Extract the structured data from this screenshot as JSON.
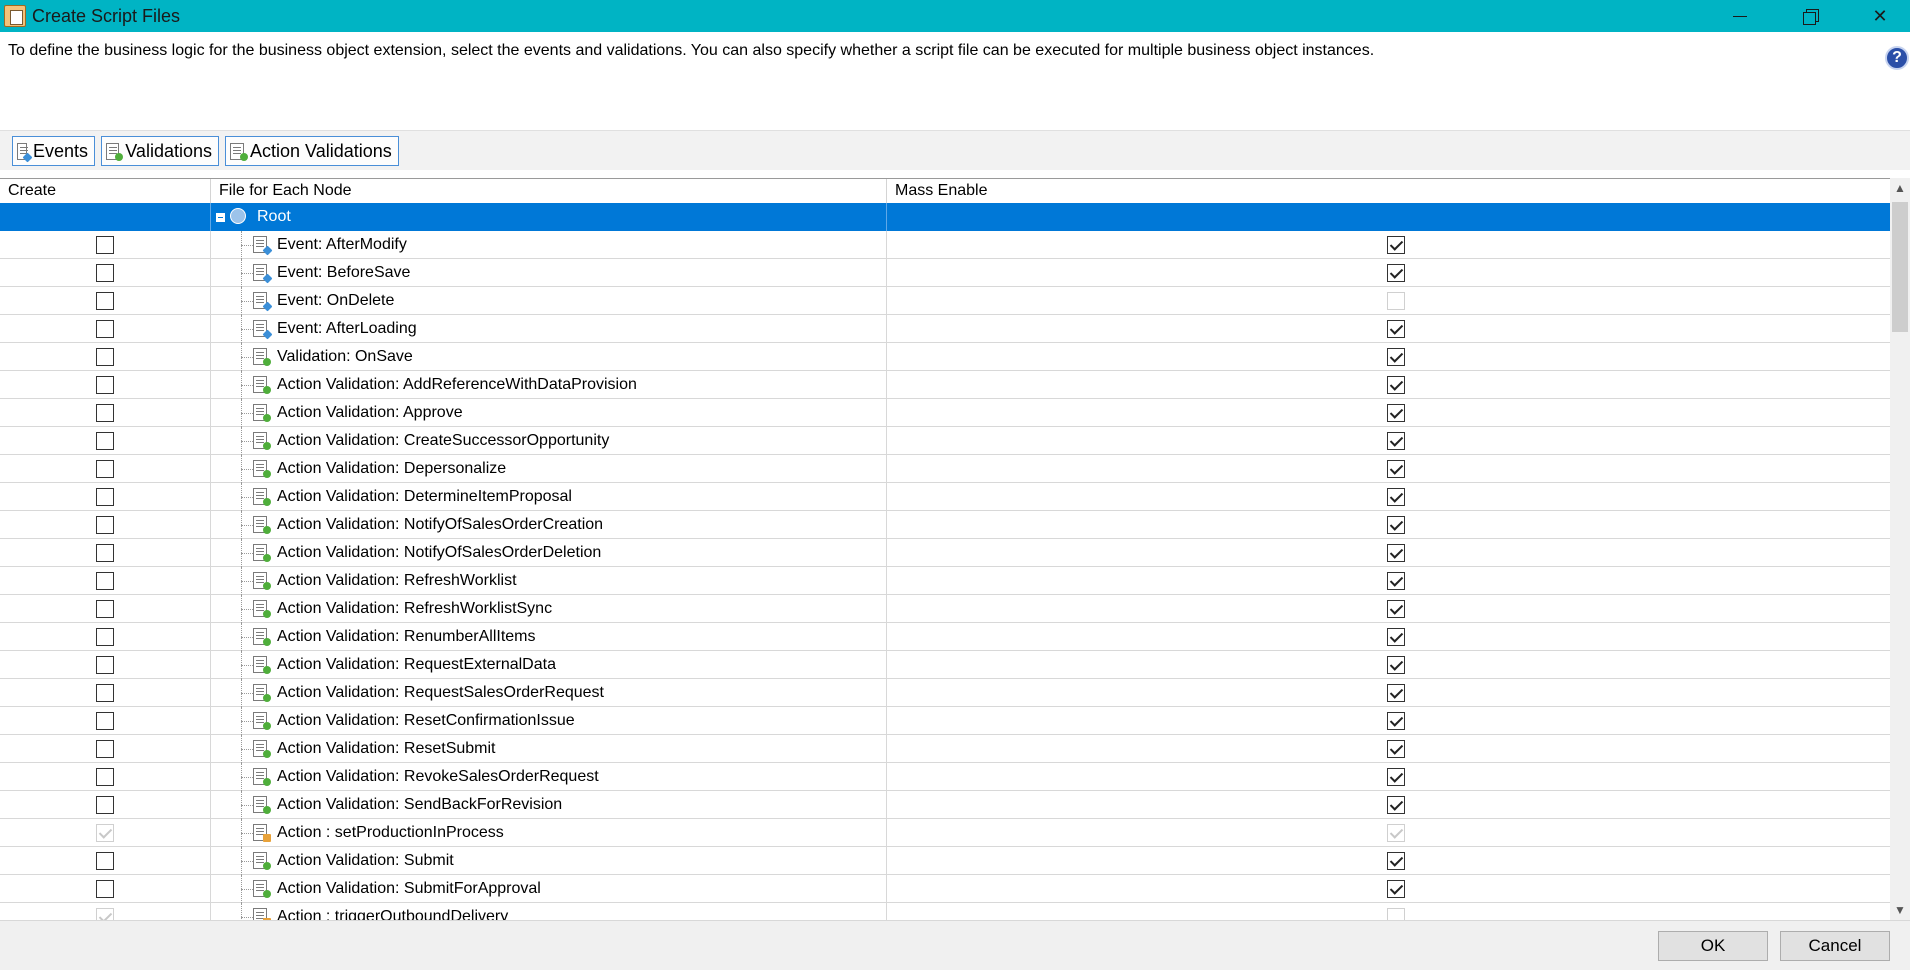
{
  "window": {
    "title": "Create Script Files",
    "title_bar_color": "#00b4c4"
  },
  "description": "To define the business logic for the business object extension, select the events and validations. You can also specify whether a script file can be executed for multiple business object instances.",
  "help": {
    "label": "?"
  },
  "toolbar": {
    "events_label": "Events",
    "validations_label": "Validations",
    "action_validations_label": "Action Validations"
  },
  "grid": {
    "columns": [
      "Create",
      "File for Each Node",
      "Mass Enable"
    ],
    "root": {
      "label": "Root",
      "selected_color": "#0078d7"
    },
    "rows": [
      {
        "label": "Event: AfterModify",
        "kind": "event",
        "create": false,
        "create_disabled": false,
        "mass": true,
        "mass_disabled": false
      },
      {
        "label": "Event: BeforeSave",
        "kind": "event",
        "create": false,
        "create_disabled": false,
        "mass": true,
        "mass_disabled": false
      },
      {
        "label": "Event: OnDelete",
        "kind": "event",
        "create": false,
        "create_disabled": false,
        "mass": false,
        "mass_disabled": true
      },
      {
        "label": "Event: AfterLoading",
        "kind": "event",
        "create": false,
        "create_disabled": false,
        "mass": true,
        "mass_disabled": false
      },
      {
        "label": "Validation: OnSave",
        "kind": "validation",
        "create": false,
        "create_disabled": false,
        "mass": true,
        "mass_disabled": false
      },
      {
        "label": "Action Validation: AddReferenceWithDataProvision",
        "kind": "validation",
        "create": false,
        "create_disabled": false,
        "mass": true,
        "mass_disabled": false
      },
      {
        "label": "Action Validation: Approve",
        "kind": "validation",
        "create": false,
        "create_disabled": false,
        "mass": true,
        "mass_disabled": false
      },
      {
        "label": "Action Validation: CreateSuccessorOpportunity",
        "kind": "validation",
        "create": false,
        "create_disabled": false,
        "mass": true,
        "mass_disabled": false
      },
      {
        "label": "Action Validation: Depersonalize",
        "kind": "validation",
        "create": false,
        "create_disabled": false,
        "mass": true,
        "mass_disabled": false
      },
      {
        "label": "Action Validation: DetermineItemProposal",
        "kind": "validation",
        "create": false,
        "create_disabled": false,
        "mass": true,
        "mass_disabled": false
      },
      {
        "label": "Action Validation: NotifyOfSalesOrderCreation",
        "kind": "validation",
        "create": false,
        "create_disabled": false,
        "mass": true,
        "mass_disabled": false
      },
      {
        "label": "Action Validation: NotifyOfSalesOrderDeletion",
        "kind": "validation",
        "create": false,
        "create_disabled": false,
        "mass": true,
        "mass_disabled": false
      },
      {
        "label": "Action Validation: RefreshWorklist",
        "kind": "validation",
        "create": false,
        "create_disabled": false,
        "mass": true,
        "mass_disabled": false
      },
      {
        "label": "Action Validation: RefreshWorklistSync",
        "kind": "validation",
        "create": false,
        "create_disabled": false,
        "mass": true,
        "mass_disabled": false
      },
      {
        "label": "Action Validation: RenumberAllItems",
        "kind": "validation",
        "create": false,
        "create_disabled": false,
        "mass": true,
        "mass_disabled": false
      },
      {
        "label": "Action Validation: RequestExternalData",
        "kind": "validation",
        "create": false,
        "create_disabled": false,
        "mass": true,
        "mass_disabled": false
      },
      {
        "label": "Action Validation: RequestSalesOrderRequest",
        "kind": "validation",
        "create": false,
        "create_disabled": false,
        "mass": true,
        "mass_disabled": false
      },
      {
        "label": "Action Validation: ResetConfirmationIssue",
        "kind": "validation",
        "create": false,
        "create_disabled": false,
        "mass": true,
        "mass_disabled": false
      },
      {
        "label": "Action Validation: ResetSubmit",
        "kind": "validation",
        "create": false,
        "create_disabled": false,
        "mass": true,
        "mass_disabled": false
      },
      {
        "label": "Action Validation: RevokeSalesOrderRequest",
        "kind": "validation",
        "create": false,
        "create_disabled": false,
        "mass": true,
        "mass_disabled": false
      },
      {
        "label": "Action Validation: SendBackForRevision",
        "kind": "validation",
        "create": false,
        "create_disabled": false,
        "mass": true,
        "mass_disabled": false
      },
      {
        "label": "Action : setProductionInProcess",
        "kind": "action",
        "create": true,
        "create_disabled": true,
        "mass": true,
        "mass_disabled": true
      },
      {
        "label": "Action Validation: Submit",
        "kind": "validation",
        "create": false,
        "create_disabled": false,
        "mass": true,
        "mass_disabled": false
      },
      {
        "label": "Action Validation: SubmitForApproval",
        "kind": "validation",
        "create": false,
        "create_disabled": false,
        "mass": true,
        "mass_disabled": false
      },
      {
        "label": "Action : triggerOutboundDelivery",
        "kind": "action",
        "create": true,
        "create_disabled": true,
        "mass": false,
        "mass_disabled": true
      }
    ]
  },
  "footer": {
    "ok_label": "OK",
    "cancel_label": "Cancel"
  }
}
